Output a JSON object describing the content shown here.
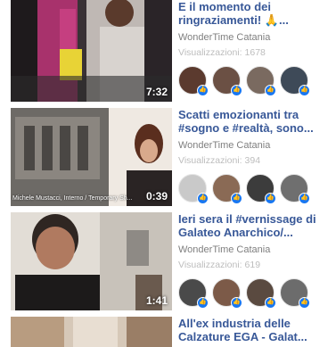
{
  "videos": [
    {
      "title": "E il momento dei ringraziamenti! 🙏...",
      "channel": "WonderTime Catania",
      "views": "Visualizzazioni: 1678",
      "duration": "7:32",
      "overlay": "",
      "avatars": [
        "#5b3a2e",
        "#6b5044",
        "#7a6a60",
        "#3e4a58"
      ]
    },
    {
      "title": "Scatti emozionanti tra #sogno e #realtà, sono...",
      "channel": "WonderTime Catania",
      "views": "Visualizzazioni: 394",
      "duration": "0:39",
      "overlay": "Michele Mustacci, Interno / Temporary Sh...",
      "avatars": [
        "#c9c9c9",
        "#8a6a55",
        "#3c3c3c",
        "#6f6f6f"
      ]
    },
    {
      "title": "Ieri sera il #vernissage di Galateo Anarchico/...",
      "channel": "WonderTime Catania",
      "views": "Visualizzazioni: 619",
      "duration": "1:41",
      "overlay": "",
      "avatars": [
        "#4a4a4a",
        "#7c5a48",
        "#5a4a40",
        "#6c6c6c"
      ]
    },
    {
      "title": "All'ex industria delle Calzature EGA - Galat...",
      "channel": "",
      "views": "",
      "duration": "",
      "overlay": "",
      "avatars": []
    }
  ],
  "colors": {
    "title": "#385898",
    "channel": "#7f7f7f",
    "views": "#bdbdbd",
    "like_badge": "#1877f2"
  },
  "icons": {
    "like_badge": "thumbs-up-icon"
  }
}
